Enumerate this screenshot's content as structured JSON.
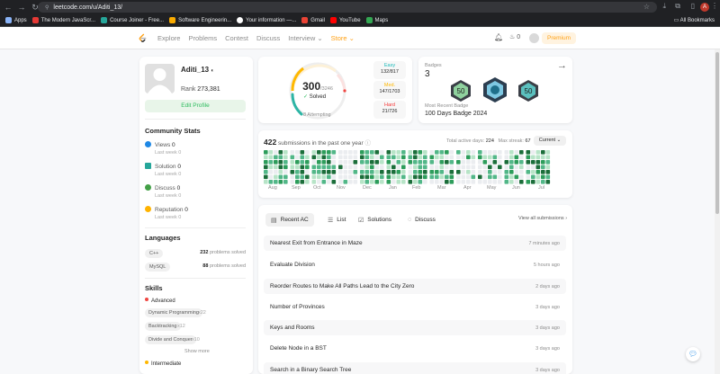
{
  "browser": {
    "url": "leetcode.com/u/Aditi_13/",
    "bookmarks": [
      {
        "label": "Apps",
        "color": "#8ab4f8"
      },
      {
        "label": "The Modern JavaScr...",
        "color": "#e53935"
      },
      {
        "label": "Course Joiner - Free...",
        "color": "#26a69a"
      },
      {
        "label": "Software Engineerin...",
        "color": "#f9ab00"
      },
      {
        "label": "Your information —...",
        "color": "#ffffff"
      },
      {
        "label": "Gmail",
        "color": "#ea4335"
      },
      {
        "label": "YouTube",
        "color": "#ff0000"
      },
      {
        "label": "Maps",
        "color": "#34a853"
      }
    ],
    "all_bookmarks": "All Bookmarks",
    "profile_initial": "A"
  },
  "nav": {
    "links": [
      "Explore",
      "Problems",
      "Contest",
      "Discuss",
      "Interview ⌄",
      "Store ⌄"
    ],
    "fire_count": "0",
    "premium": "Premium"
  },
  "profile": {
    "username": "Aditi_13",
    "rank_label": "Rank",
    "rank": "273,381",
    "edit": "Edit Profile"
  },
  "community": {
    "title": "Community Stats",
    "items": [
      {
        "label": "Views",
        "value": "0",
        "sub": "Last week",
        "subval": "0",
        "color": "#1e88e5"
      },
      {
        "label": "Solution",
        "value": "0",
        "sub": "Last week",
        "subval": "0",
        "color": "#26a69a"
      },
      {
        "label": "Discuss",
        "value": "0",
        "sub": "Last week",
        "subval": "0",
        "color": "#43a047"
      },
      {
        "label": "Reputation",
        "value": "0",
        "sub": "Last week",
        "subval": "0",
        "color": "#ffb300"
      }
    ]
  },
  "languages": {
    "title": "Languages",
    "items": [
      {
        "name": "C++",
        "count": "232",
        "suffix": "problems solved"
      },
      {
        "name": "MySQL",
        "count": "88",
        "suffix": "problems solved"
      }
    ]
  },
  "skills": {
    "title": "Skills",
    "advanced": "Advanced",
    "items": [
      {
        "name": "Dynamic Programming",
        "count": "x22"
      },
      {
        "name": "Backtracking",
        "count": "x12"
      },
      {
        "name": "Divide and Conquer",
        "count": "x10"
      }
    ],
    "show_more": "Show more",
    "intermediate": "Intermediate"
  },
  "solved": {
    "count": "300",
    "total": "/3246",
    "label": "Solved",
    "attempting": "8 Attempting",
    "easy": {
      "label": "Easy",
      "value": "132/817"
    },
    "medium": {
      "label": "Med.",
      "value": "147/1703"
    },
    "hard": {
      "label": "Hard",
      "value": "21/726"
    }
  },
  "badges": {
    "label": "Badges",
    "count": "3",
    "recent_label": "Most Recent Badge",
    "recent_name": "100 Days Badge 2024",
    "icon_labels": [
      "50",
      "",
      "50"
    ]
  },
  "submissions": {
    "count": "422",
    "text": "submissions in the past one year",
    "active_label": "Total active days:",
    "active": "224",
    "streak_label": "Max streak:",
    "streak": "67",
    "current": "Current",
    "months": [
      "Aug",
      "Sep",
      "Oct",
      "Nov",
      "Dec",
      "Jan",
      "Feb",
      "Mar",
      "Apr",
      "May",
      "Jun",
      "Jul"
    ]
  },
  "recent": {
    "tabs": [
      "Recent AC",
      "List",
      "Solutions",
      "Discuss"
    ],
    "view_all": "View all submissions",
    "rows": [
      {
        "title": "Nearest Exit from Entrance in Maze",
        "time": "7 minutes ago"
      },
      {
        "title": "Evaluate Division",
        "time": "5 hours ago"
      },
      {
        "title": "Reorder Routes to Make All Paths Lead to the City Zero",
        "time": "2 days ago"
      },
      {
        "title": "Number of Provinces",
        "time": "3 days ago"
      },
      {
        "title": "Keys and Rooms",
        "time": "3 days ago"
      },
      {
        "title": "Delete Node in a BST",
        "time": "3 days ago"
      },
      {
        "title": "Search in a Binary Search Tree",
        "time": "3 days ago"
      }
    ]
  }
}
